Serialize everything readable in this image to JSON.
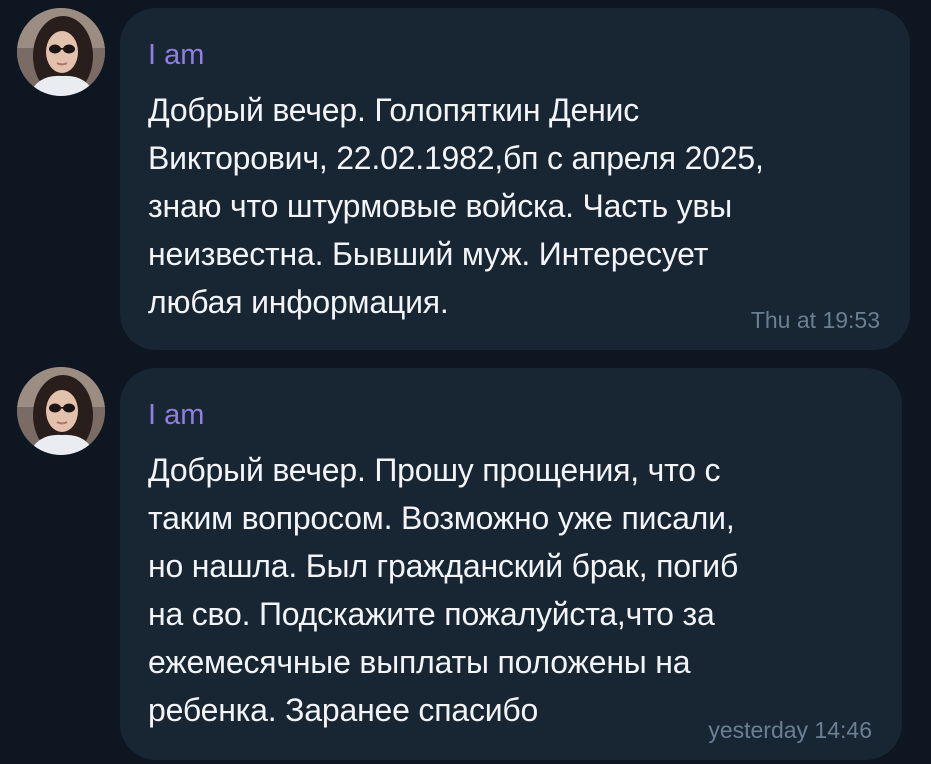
{
  "messages": [
    {
      "sender": "I am",
      "text": "Добрый вечер. Голопяткин  Денис\nВикторович, 22.02.1982,бп с апреля 2025,\nзнаю что штурмовые войска. Часть увы\nнеизвестна. Бывший муж. Интересует\nлюбая информация.",
      "time": "Thu at 19:53",
      "avatar_icon": "user-avatar"
    },
    {
      "sender": "I am",
      "text": "Добрый вечер. Прошу прощения, что с\nтаким вопросом. Возможно уже писали,\nно нашла. Был гражданский брак, погиб\nна сво. Подскажите пожалуйста,что за\nежемесячные выплаты положены на\nребенка. Заранее спасибо",
      "time": "yesterday 14:46",
      "avatar_icon": "user-avatar"
    }
  ],
  "colors": {
    "background": "#0e1621",
    "bubble": "#182533",
    "sender_name": "#8e7fe0",
    "message_text": "#f2f4f7",
    "timestamp": "#6c7f92"
  }
}
